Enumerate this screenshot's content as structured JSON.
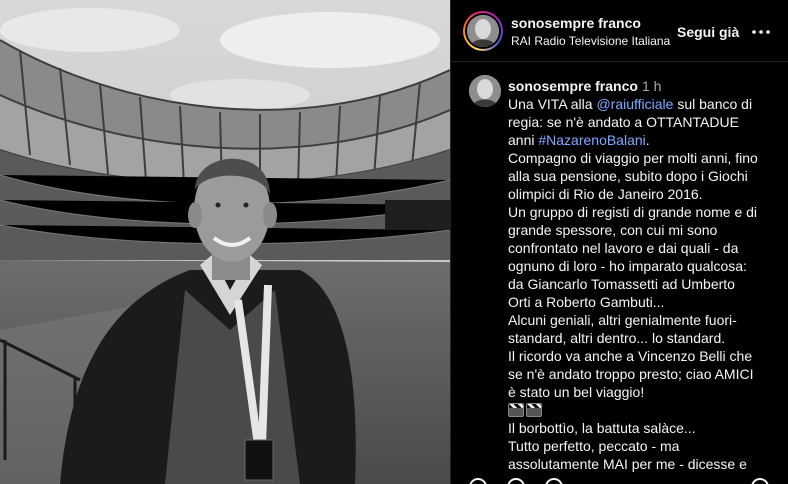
{
  "post": {
    "image_alt": "Black and white photo of a smiling man in a jacket with a lanyard, standing in a stadium",
    "author": {
      "username": "sonosempre franco",
      "subtitle": "RAI Radio Televisione Italiana",
      "follow_label": "Segui già",
      "more_icon": "more-horizontal-icon"
    },
    "caption": {
      "username": "sonosempre franco",
      "time": "1 h",
      "lines": [
        {
          "parts": [
            {
              "t": "Una VITA alla "
            },
            {
              "t": "@raiufficiale",
              "link": true
            },
            {
              "t": " sul banco di"
            }
          ]
        },
        {
          "parts": [
            {
              "t": "regia: se n'è andato a OTTANTADUE"
            }
          ]
        },
        {
          "parts": [
            {
              "t": "anni "
            },
            {
              "t": "#NazarenoBalani",
              "link": true
            },
            {
              "t": "."
            }
          ]
        },
        {
          "parts": [
            {
              "t": "Compagno di viaggio per molti anni, fino"
            }
          ]
        },
        {
          "parts": [
            {
              "t": "alla sua pensione, subito dopo i Giochi"
            }
          ]
        },
        {
          "parts": [
            {
              "t": "olimpici di Rio de Janeiro 2016."
            }
          ]
        },
        {
          "parts": [
            {
              "t": "Un gruppo di registi di grande nome e di"
            }
          ]
        },
        {
          "parts": [
            {
              "t": "grande spessore, con cui mi sono"
            }
          ]
        },
        {
          "parts": [
            {
              "t": "confrontato nel lavoro e dai quali - da"
            }
          ]
        },
        {
          "parts": [
            {
              "t": "ognuno di loro - ho imparato qualcosa:"
            }
          ]
        },
        {
          "parts": [
            {
              "t": "da Giancarlo Tomassetti ad Umberto"
            }
          ]
        },
        {
          "parts": [
            {
              "t": "Orti a Roberto Gambuti..."
            }
          ]
        },
        {
          "parts": [
            {
              "t": "Alcuni geniali, altri genialmente fuori-"
            }
          ]
        },
        {
          "parts": [
            {
              "t": "standard, altri dentro... lo standard."
            }
          ]
        },
        {
          "parts": [
            {
              "t": "Il ricordo va anche a Vincenzo Belli che"
            }
          ]
        },
        {
          "parts": [
            {
              "t": "se n'è andato troppo presto; ciao AMICI"
            }
          ]
        },
        {
          "parts": [
            {
              "t": "è stato un bel viaggio!"
            }
          ]
        },
        {
          "parts": [],
          "clappers": true
        },
        {
          "parts": [
            {
              "t": "Il borbottìo, la battuta salàce..."
            }
          ]
        },
        {
          "parts": [
            {
              "t": "Tutto perfetto, peccato - ma"
            }
          ]
        },
        {
          "parts": [
            {
              "t": "assolutamente MAI per me - dicesse e"
            }
          ]
        }
      ]
    }
  }
}
